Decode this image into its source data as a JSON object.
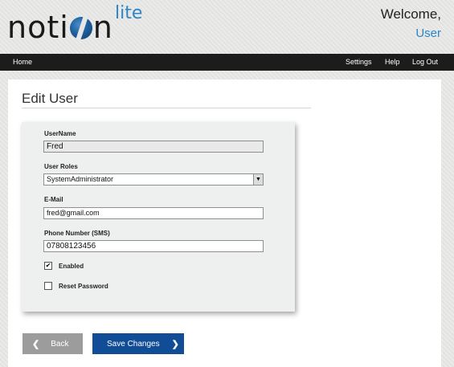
{
  "header": {
    "logo_text_before": "noti",
    "logo_text_after": "n",
    "logo_lite": "lite",
    "welcome_text": "Welcome,",
    "username": "User"
  },
  "nav": {
    "home": "Home",
    "settings": "Settings",
    "help": "Help",
    "logout": "Log Out"
  },
  "page": {
    "title": "Edit User"
  },
  "form": {
    "username_label": "UserName",
    "username_value": "Fred",
    "roles_label": "User Roles",
    "roles_selected": "SystemAdministrator",
    "email_label": "E-Mail",
    "email_value": "fred@gmail.com",
    "phone_label": "Phone Number (SMS)",
    "phone_value": "07808123456",
    "enabled_label": "Enabled",
    "enabled_checked": true,
    "reset_label": "Reset Password",
    "reset_checked": false
  },
  "buttons": {
    "back_label": "Back",
    "save_label": "Save Changes"
  },
  "colors": {
    "accent": "#2a86c8",
    "nav_bg": "#1c1c1c",
    "save_button": "#114d96",
    "back_button": "#9c9c9c"
  },
  "icons": {
    "back": "chevron-left-icon",
    "save": "chevron-right-icon",
    "select": "dropdown-arrow-icon"
  }
}
